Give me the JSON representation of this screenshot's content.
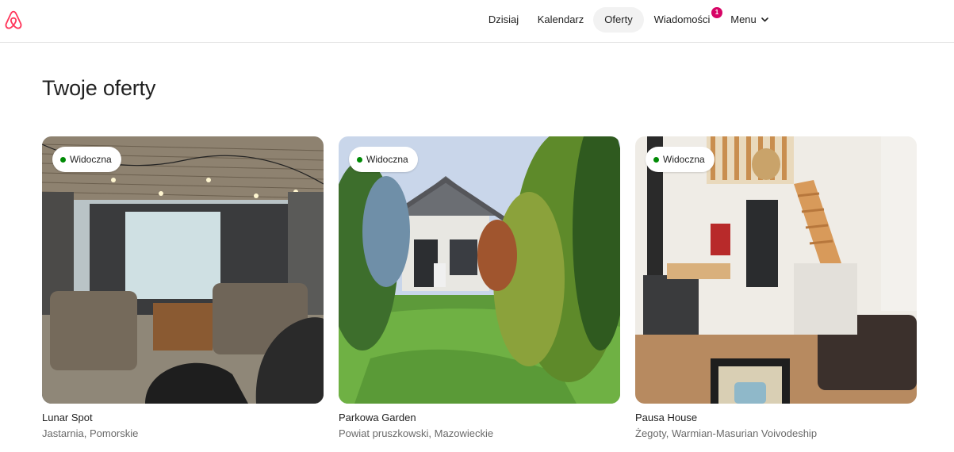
{
  "header": {
    "logo_icon": "airbnb-logo-icon",
    "brand_color": "#ff385c",
    "nav": [
      {
        "label": "Dzisiaj",
        "active": false
      },
      {
        "label": "Kalendarz",
        "active": false
      },
      {
        "label": "Oferty",
        "active": true
      },
      {
        "label": "Wiadomości",
        "active": false,
        "badge": "1"
      },
      {
        "label": "Menu",
        "active": false,
        "icon": "chevron-down-icon"
      }
    ],
    "badge_color": "#d70466"
  },
  "main": {
    "title": "Twoje oferty",
    "listings": [
      {
        "status": "Widoczna",
        "status_color": "#008a05",
        "name": "Lunar Spot",
        "location": "Jastarnia, Pomorskie"
      },
      {
        "status": "Widoczna",
        "status_color": "#008a05",
        "name": "Parkowa Garden",
        "location": "Powiat pruszkowski, Mazowieckie"
      },
      {
        "status": "Widoczna",
        "status_color": "#008a05",
        "name": "Pausa House",
        "location": "Żegoty, Warmian-Masurian Voivodeship"
      }
    ]
  }
}
